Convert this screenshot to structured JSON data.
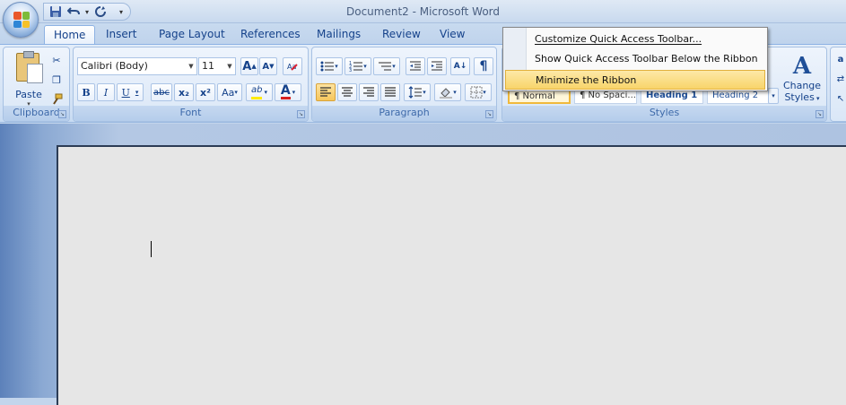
{
  "window": {
    "title": "Document2 - Microsoft Word"
  },
  "tabs": [
    {
      "label": "Home",
      "active": true
    },
    {
      "label": "Insert"
    },
    {
      "label": "Page Layout"
    },
    {
      "label": "References"
    },
    {
      "label": "Mailings"
    },
    {
      "label": "Review"
    },
    {
      "label": "View"
    }
  ],
  "clipboard": {
    "paste_label": "Paste",
    "group_label": "Clipboard"
  },
  "font": {
    "name": "Calibri (Body)",
    "size": "11",
    "group_label": "Font",
    "grow": "A",
    "shrink": "A",
    "bold": "B",
    "italic": "I",
    "underline": "U",
    "strike": "abc",
    "subscript": "x₂",
    "superscript": "x²",
    "case": "Aa",
    "highlight": "ab",
    "color": "A",
    "font_color_hex": "#d62020",
    "highlight_hex": "#ffeb00"
  },
  "paragraph": {
    "group_label": "Paragraph",
    "pilcrow": "¶",
    "sort": "A↓"
  },
  "styles": {
    "group_label": "Styles",
    "items": [
      "¶ Normal",
      "¶ No Spaci...",
      "Heading 1",
      "Heading 2"
    ],
    "change_line1": "Change",
    "change_line2": "Styles"
  },
  "menu": {
    "items": [
      {
        "label": "Customize Quick Access Toolbar...",
        "mnemonic": "C"
      },
      {
        "label": "Show Quick Access Toolbar Below the Ribbon",
        "mnemonic": "S"
      },
      {
        "label": "Minimize the Ribbon",
        "mnemonic": "n",
        "highlighted": true
      }
    ]
  },
  "colors": {
    "accent": "#15428b",
    "ribbon_bg": "#dbe6f4",
    "menu_highlight": "#f8d46a"
  }
}
